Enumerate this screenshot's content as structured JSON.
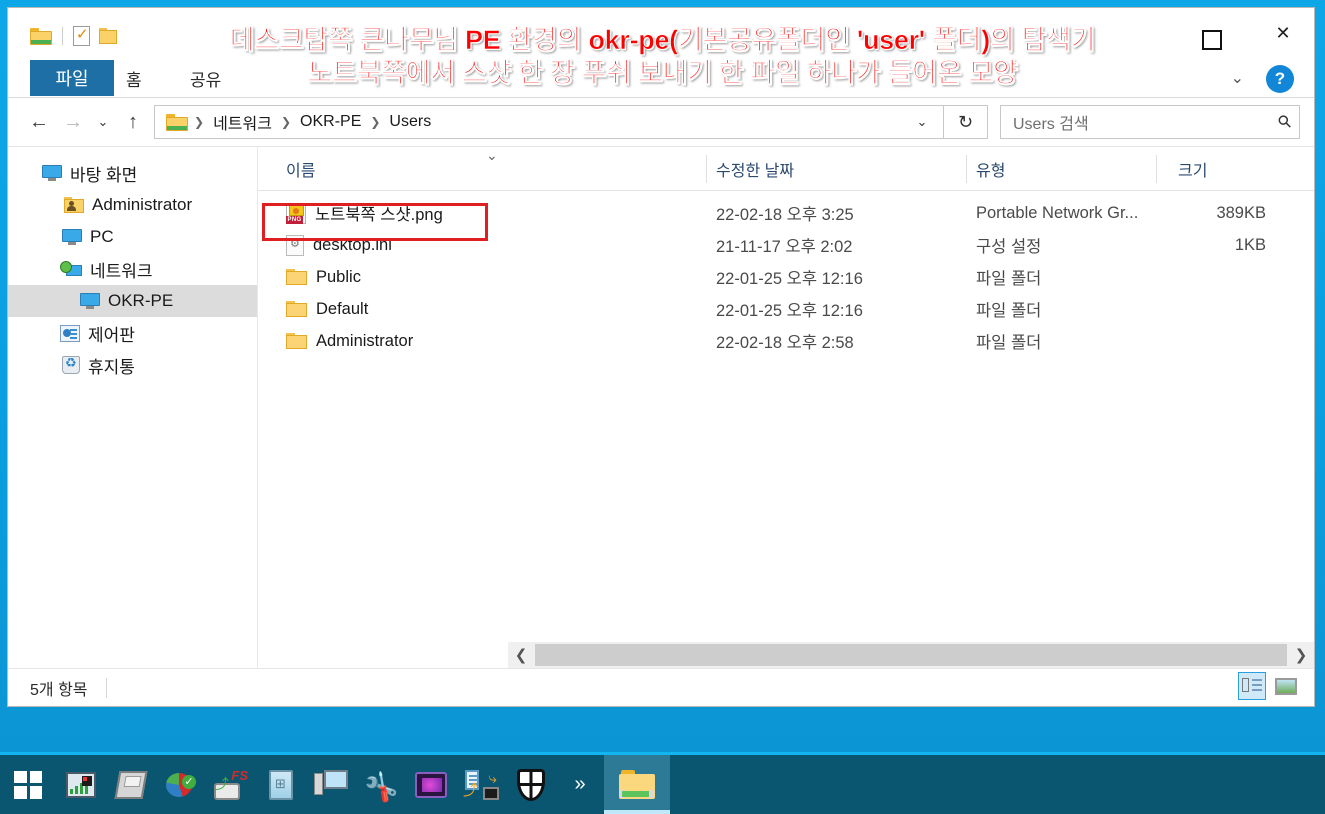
{
  "window": {
    "quick_access": [
      "folder-icon",
      "properties-checkbox-icon",
      "new-folder-icon"
    ],
    "maximize_label": "",
    "close_label": "✕",
    "ribbon_collapse_label": "⌄",
    "help_label": "?"
  },
  "ribbon": {
    "tabs": [
      {
        "label": "파일",
        "active": true
      },
      {
        "label": "홈",
        "active": false
      },
      {
        "label": "공유",
        "active": false
      }
    ]
  },
  "annotation": {
    "line1": "데스크탑쪽 큰나무님 PE 환경의 okr-pe(기본공유폴더인 'user' 폴더)의 탐색기",
    "line2": "노트북쪽에서 스샷 한 장 푸쉬 보내기 한 파일 하나가 들어온 모양",
    "color": "#ff0000"
  },
  "address_bar": {
    "back_label": "←",
    "forward_label": "→",
    "recent_label": "⌄",
    "up_label": "↑",
    "breadcrumbs": [
      "네트워크",
      "OKR-PE",
      "Users"
    ],
    "separator": "❯",
    "dropdown_label": "⌄",
    "refresh_label": "↻"
  },
  "search": {
    "placeholder": "Users 검색",
    "icon": "search-icon"
  },
  "sidebar": {
    "items": [
      {
        "label": "바탕 화면",
        "icon": "desktop-icon",
        "indent": 0,
        "selected": false
      },
      {
        "label": "Administrator",
        "icon": "user-folder-icon",
        "indent": 1,
        "selected": false
      },
      {
        "label": "PC",
        "icon": "computer-icon",
        "indent": 1,
        "selected": false
      },
      {
        "label": "네트워크",
        "icon": "network-icon",
        "indent": 1,
        "selected": false
      },
      {
        "label": "OKR-PE",
        "icon": "computer-icon",
        "indent": 2,
        "selected": true
      },
      {
        "label": "제어판",
        "icon": "control-panel-icon",
        "indent": 1,
        "selected": false
      },
      {
        "label": "휴지통",
        "icon": "recycle-bin-icon",
        "indent": 1,
        "selected": false
      }
    ]
  },
  "file_list": {
    "columns": [
      "이름",
      "수정한 날짜",
      "유형",
      "크기"
    ],
    "sort_indicator": "⌄",
    "rows": [
      {
        "name": "노트북쪽 스샷.png",
        "icon": "png-file-icon",
        "date": "22-02-18 오후 3:25",
        "type": "Portable Network Gr...",
        "size": "389KB",
        "highlighted": true
      },
      {
        "name": "desktop.ini",
        "icon": "ini-file-icon",
        "date": "21-11-17 오후 2:02",
        "type": "구성 설정",
        "size": "1KB",
        "highlighted": false
      },
      {
        "name": "Public",
        "icon": "folder-icon",
        "date": "22-01-25 오후 12:16",
        "type": "파일 폴더",
        "size": "",
        "highlighted": false
      },
      {
        "name": "Default",
        "icon": "folder-icon",
        "date": "22-01-25 오후 12:16",
        "type": "파일 폴더",
        "size": "",
        "highlighted": false
      },
      {
        "name": "Administrator",
        "icon": "folder-icon",
        "date": "22-02-18 오후 2:58",
        "type": "파일 폴더",
        "size": "",
        "highlighted": false
      }
    ]
  },
  "scrollbar": {
    "left_label": "❮",
    "right_label": "❯"
  },
  "status_bar": {
    "item_count": "5개 항목",
    "view_details_label": "details-view-icon",
    "view_thumbnails_label": "large-icons-view-icon"
  },
  "taskbar": {
    "start_label": "windows-start-icon",
    "overflow_label": "»",
    "items": [
      {
        "name": "network-monitor-icon"
      },
      {
        "name": "floppy-disk-icon"
      },
      {
        "name": "partition-manager-icon"
      },
      {
        "name": "fs-backup-icon"
      },
      {
        "name": "windows-book-icon"
      },
      {
        "name": "pc-setup-icon"
      },
      {
        "name": "tools-icon"
      },
      {
        "name": "media-player-icon"
      },
      {
        "name": "backup-restore-icon"
      },
      {
        "name": "security-shield-icon"
      }
    ],
    "active_window": "file-explorer-icon"
  }
}
